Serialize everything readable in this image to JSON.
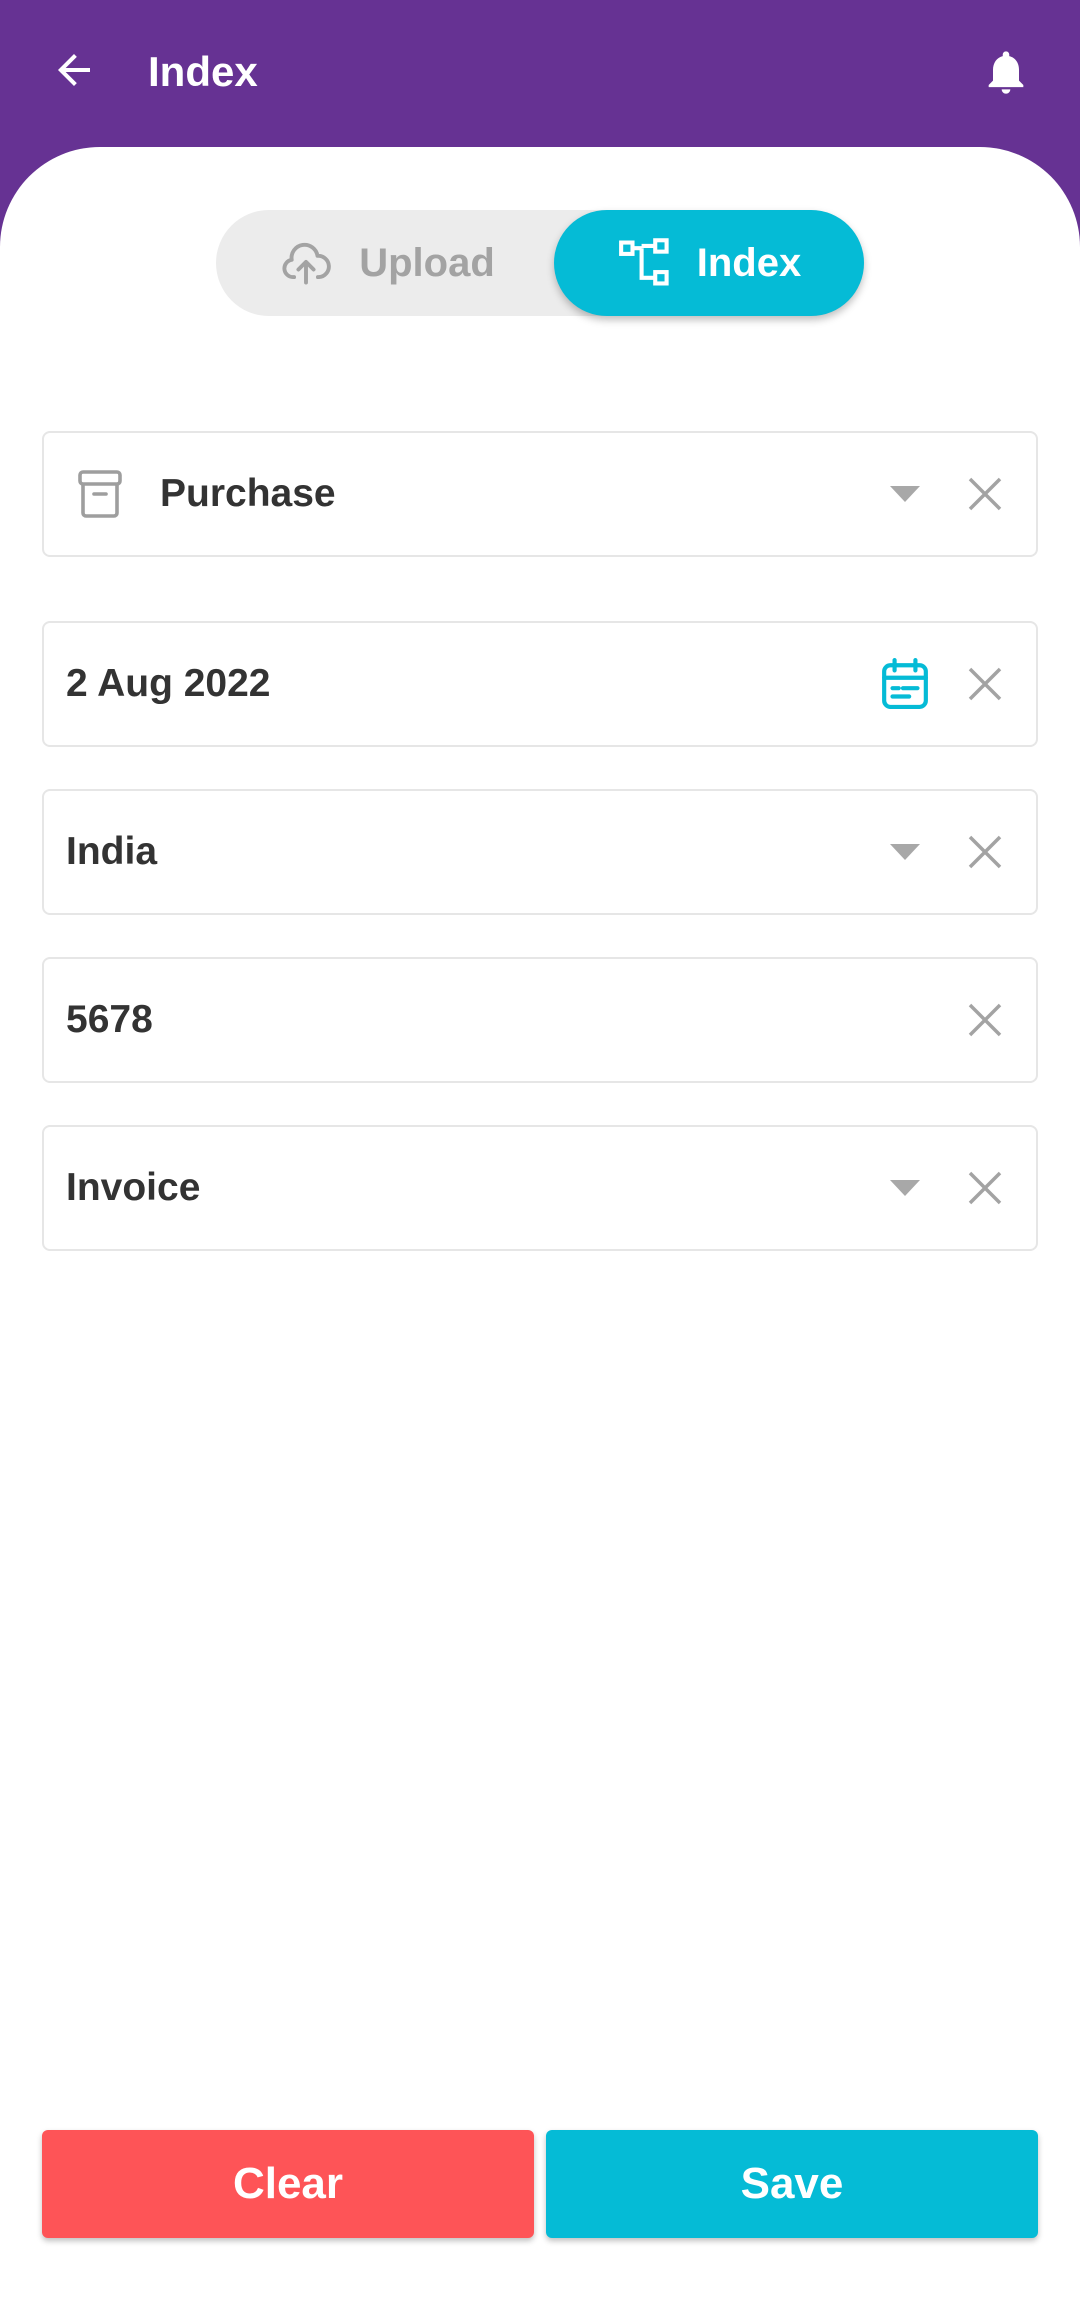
{
  "app_bar": {
    "title": "Index",
    "back_icon": "arrow-back-icon",
    "bell_icon": "bell-icon",
    "background": "#663293"
  },
  "toggle": {
    "upload_label": "Upload",
    "upload_icon": "cloud-upload-icon",
    "index_label": "Index",
    "index_icon": "hierarchy-icon",
    "active": "Index",
    "active_color": "#05bbd6"
  },
  "fields": {
    "category": {
      "value": "Purchase",
      "icon": "archive-box-icon"
    },
    "date": {
      "value": "2 Aug 2022",
      "icon": "calendar-icon"
    },
    "country": {
      "value": "India"
    },
    "number": {
      "value": "5678"
    },
    "doc_type": {
      "value": "Invoice"
    }
  },
  "actions": {
    "clear_label": "Clear",
    "clear_color": "#fe5457",
    "save_label": "Save",
    "save_color": "#05bbd6"
  }
}
